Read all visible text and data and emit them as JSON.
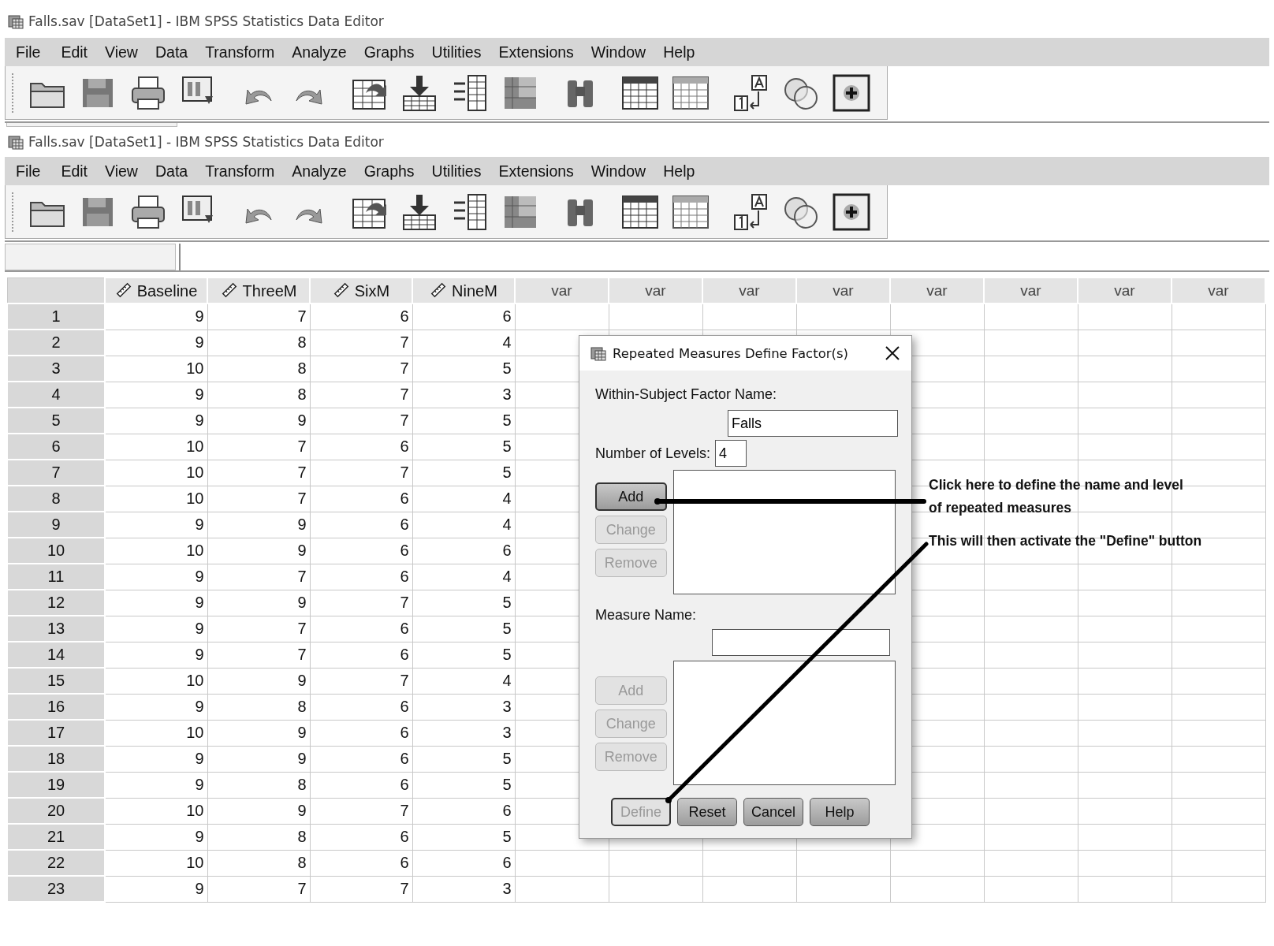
{
  "background_window": {
    "title": "Falls.sav [DataSet1] - IBM SPSS Statistics Data Editor",
    "menu": [
      "File",
      "Edit",
      "View",
      "Data",
      "Transform",
      "Analyze",
      "Graphs",
      "Utilities",
      "Extensions",
      "Window",
      "Help"
    ]
  },
  "window": {
    "title": "Falls.sav [DataSet1] - IBM SPSS Statistics Data Editor",
    "menu": [
      "File",
      "Edit",
      "View",
      "Data",
      "Transform",
      "Analyze",
      "Graphs",
      "Utilities",
      "Extensions",
      "Window",
      "Help"
    ]
  },
  "grid": {
    "columns": [
      {
        "name": "Baseline",
        "kind": "scale"
      },
      {
        "name": "ThreeM",
        "kind": "scale"
      },
      {
        "name": "SixM",
        "kind": "scale"
      },
      {
        "name": "NineM",
        "kind": "scale"
      },
      {
        "name": "var",
        "kind": "empty"
      },
      {
        "name": "var",
        "kind": "empty"
      },
      {
        "name": "var",
        "kind": "empty"
      },
      {
        "name": "var",
        "kind": "empty"
      },
      {
        "name": "var",
        "kind": "empty"
      },
      {
        "name": "var",
        "kind": "empty"
      },
      {
        "name": "var",
        "kind": "empty"
      },
      {
        "name": "var",
        "kind": "empty"
      }
    ],
    "rows": [
      {
        "number": "1",
        "cells": [
          "9",
          "7",
          "6",
          "6"
        ]
      },
      {
        "number": "2",
        "cells": [
          "9",
          "8",
          "7",
          "4"
        ]
      },
      {
        "number": "3",
        "cells": [
          "10",
          "8",
          "7",
          "5"
        ]
      },
      {
        "number": "4",
        "cells": [
          "9",
          "8",
          "7",
          "3"
        ]
      },
      {
        "number": "5",
        "cells": [
          "9",
          "9",
          "7",
          "5"
        ]
      },
      {
        "number": "6",
        "cells": [
          "10",
          "7",
          "6",
          "5"
        ]
      },
      {
        "number": "7",
        "cells": [
          "10",
          "7",
          "7",
          "5"
        ]
      },
      {
        "number": "8",
        "cells": [
          "10",
          "7",
          "6",
          "4"
        ]
      },
      {
        "number": "9",
        "cells": [
          "9",
          "9",
          "6",
          "4"
        ]
      },
      {
        "number": "10",
        "cells": [
          "10",
          "9",
          "6",
          "6"
        ]
      },
      {
        "number": "11",
        "cells": [
          "9",
          "7",
          "6",
          "4"
        ]
      },
      {
        "number": "12",
        "cells": [
          "9",
          "9",
          "7",
          "5"
        ]
      },
      {
        "number": "13",
        "cells": [
          "9",
          "7",
          "6",
          "5"
        ]
      },
      {
        "number": "14",
        "cells": [
          "9",
          "7",
          "6",
          "5"
        ]
      },
      {
        "number": "15",
        "cells": [
          "10",
          "9",
          "7",
          "4"
        ]
      },
      {
        "number": "16",
        "cells": [
          "9",
          "8",
          "6",
          "3"
        ]
      },
      {
        "number": "17",
        "cells": [
          "10",
          "9",
          "6",
          "3"
        ]
      },
      {
        "number": "18",
        "cells": [
          "9",
          "9",
          "6",
          "5"
        ]
      },
      {
        "number": "19",
        "cells": [
          "9",
          "8",
          "6",
          "5"
        ]
      },
      {
        "number": "20",
        "cells": [
          "10",
          "9",
          "7",
          "6"
        ]
      },
      {
        "number": "21",
        "cells": [
          "9",
          "8",
          "6",
          "5"
        ]
      },
      {
        "number": "22",
        "cells": [
          "10",
          "8",
          "6",
          "6"
        ]
      },
      {
        "number": "23",
        "cells": [
          "9",
          "7",
          "7",
          "3"
        ]
      }
    ]
  },
  "dialog": {
    "title": "Repeated Measures Define Factor(s)",
    "factor_label": "Within-Subject Factor Name:",
    "factor_value": "Falls",
    "levels_label": "Number of Levels:",
    "levels_value": "4",
    "factor_buttons": [
      {
        "label": "Add",
        "disabled": false
      },
      {
        "label": "Change",
        "disabled": true
      },
      {
        "label": "Remove",
        "disabled": true
      }
    ],
    "measure_label": "Measure Name:",
    "measure_buttons": [
      {
        "label": "Add",
        "disabled": true
      },
      {
        "label": "Change",
        "disabled": true
      },
      {
        "label": "Remove",
        "disabled": true
      }
    ],
    "footer_buttons": [
      {
        "label": "Define",
        "disabled": true
      },
      {
        "label": "Reset",
        "disabled": false
      },
      {
        "label": "Cancel",
        "disabled": false
      },
      {
        "label": "Help",
        "disabled": false
      }
    ]
  },
  "annotations": [
    {
      "lines": [
        "Click here to define the name and level",
        "of repeated measures"
      ]
    },
    {
      "lines": [
        "This will then activate the \"Define\" button"
      ]
    }
  ]
}
